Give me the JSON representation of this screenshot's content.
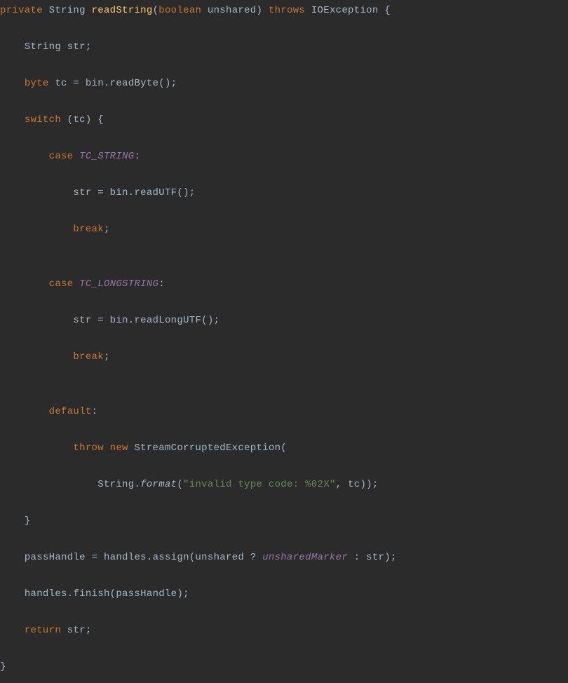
{
  "code": {
    "l1": {
      "kw1": "private",
      "type1": "String",
      "method": "readString",
      "lp": "(",
      "kw2": "boolean",
      "param": "unshared",
      "rp": ")",
      "kw3": "throws",
      "ex": "IOException",
      "ob": "{"
    },
    "l2": {
      "indent": "    ",
      "type": "String",
      "ident": "str",
      "sc": ";"
    },
    "l3": {
      "indent": "    ",
      "kw": "byte",
      "ident": "tc",
      "eq": " = ",
      "obj": "bin",
      "dot": ".",
      "call": "readByte",
      "paren": "()",
      "sc": ";"
    },
    "l4": {
      "indent": "    ",
      "kw": "switch",
      "sp": " ",
      "lp": "(",
      "ident": "tc",
      "rp": ")",
      "ob": " {"
    },
    "l5": {
      "indent": "        ",
      "kw": "case",
      "sp": " ",
      "const": "TC_STRING",
      "col": ":"
    },
    "l6": {
      "indent": "            ",
      "lhs": "str",
      "eq": " = ",
      "obj": "bin",
      "dot": ".",
      "call": "readUTF",
      "paren": "()",
      "sc": ";"
    },
    "l7": {
      "indent": "            ",
      "kw": "break",
      "sc": ";"
    },
    "l8": {
      "indent": ""
    },
    "l9": {
      "indent": "        ",
      "kw": "case",
      "sp": " ",
      "const": "TC_LONGSTRING",
      "col": ":"
    },
    "l10": {
      "indent": "            ",
      "lhs": "str",
      "eq": " = ",
      "obj": "bin",
      "dot": ".",
      "call": "readLongUTF",
      "paren": "()",
      "sc": ";"
    },
    "l11": {
      "indent": "            ",
      "kw": "break",
      "sc": ";"
    },
    "l12": {
      "indent": ""
    },
    "l13": {
      "indent": "        ",
      "kw": "default",
      "col": ":"
    },
    "l14": {
      "indent": "            ",
      "kw1": "throw",
      "sp": " ",
      "kw2": "new",
      "sp2": " ",
      "cls": "StreamCorruptedException",
      "lp": "("
    },
    "l15": {
      "indent": "                ",
      "cls": "String",
      "dot": ".",
      "call": "format",
      "lp": "(",
      "str": "\"invalid type code: %02X\"",
      "comma": ", ",
      "arg": "tc",
      "rp": "))",
      "sc": ";"
    },
    "l16": {
      "indent": "    ",
      "cb": "}"
    },
    "l17": {
      "indent": "    ",
      "lhs": "passHandle",
      "eq": " = ",
      "obj": "handles",
      "dot": ".",
      "call": "assign",
      "lp": "(",
      "arg1": "unshared",
      "tern1": " ? ",
      "const": "unsharedMarker",
      "tern2": " : ",
      "arg2": "str",
      "rp": ")",
      "sc": ";"
    },
    "l18": {
      "indent": "    ",
      "obj": "handles",
      "dot": ".",
      "call": "finish",
      "lp": "(",
      "arg": "passHandle",
      "rp": ")",
      "sc": ";"
    },
    "l19": {
      "indent": "    ",
      "kw": "return",
      "sp": " ",
      "ident": "str",
      "sc": ";"
    },
    "l20": {
      "cb": "}"
    }
  }
}
